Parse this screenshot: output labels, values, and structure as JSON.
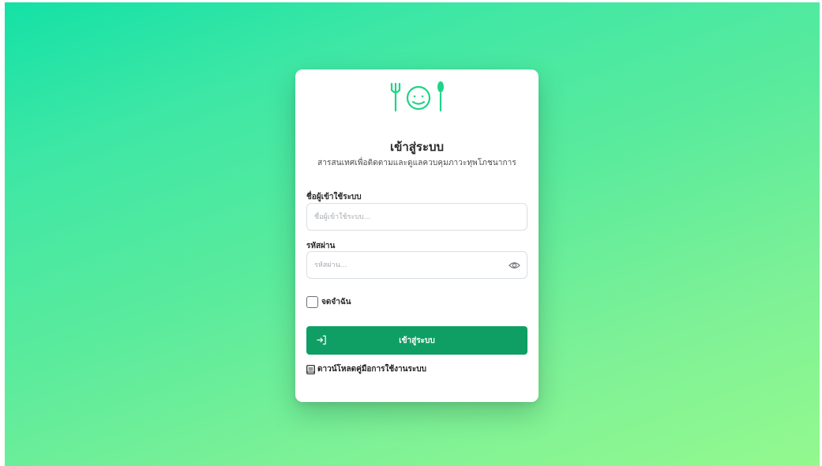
{
  "colors": {
    "accent": "#0f9f64",
    "logo": "#1ed488",
    "background_start": "#14e1a6",
    "background_end": "#93f98e"
  },
  "logo": {
    "icon": "fork-face-spoon-icon"
  },
  "login": {
    "title": "เข้าสู่ระบบ",
    "subtitle": "สารสนเทศเพื่อติดตามและดูแลควบคุมภาวะทุพโภชนาการ",
    "username_label": "ชื่อผู้เข้าใช้ระบบ",
    "username_placeholder": "ชื่อผู้เข้าใช้ระบบ...",
    "username_value": "",
    "password_label": "รหัสผ่าน",
    "password_placeholder": "รหัสผ่าน...",
    "password_value": "",
    "password_toggle_icon": "eye-icon",
    "remember_label": "จดจำฉัน",
    "remember_checked": false,
    "submit_label": "เข้าสู่ระบบ",
    "submit_icon": "sign-in-icon",
    "download_label": "ดาวน์โหลดคู่มือการใช้งานระบบ",
    "download_icon": "book-icon"
  }
}
